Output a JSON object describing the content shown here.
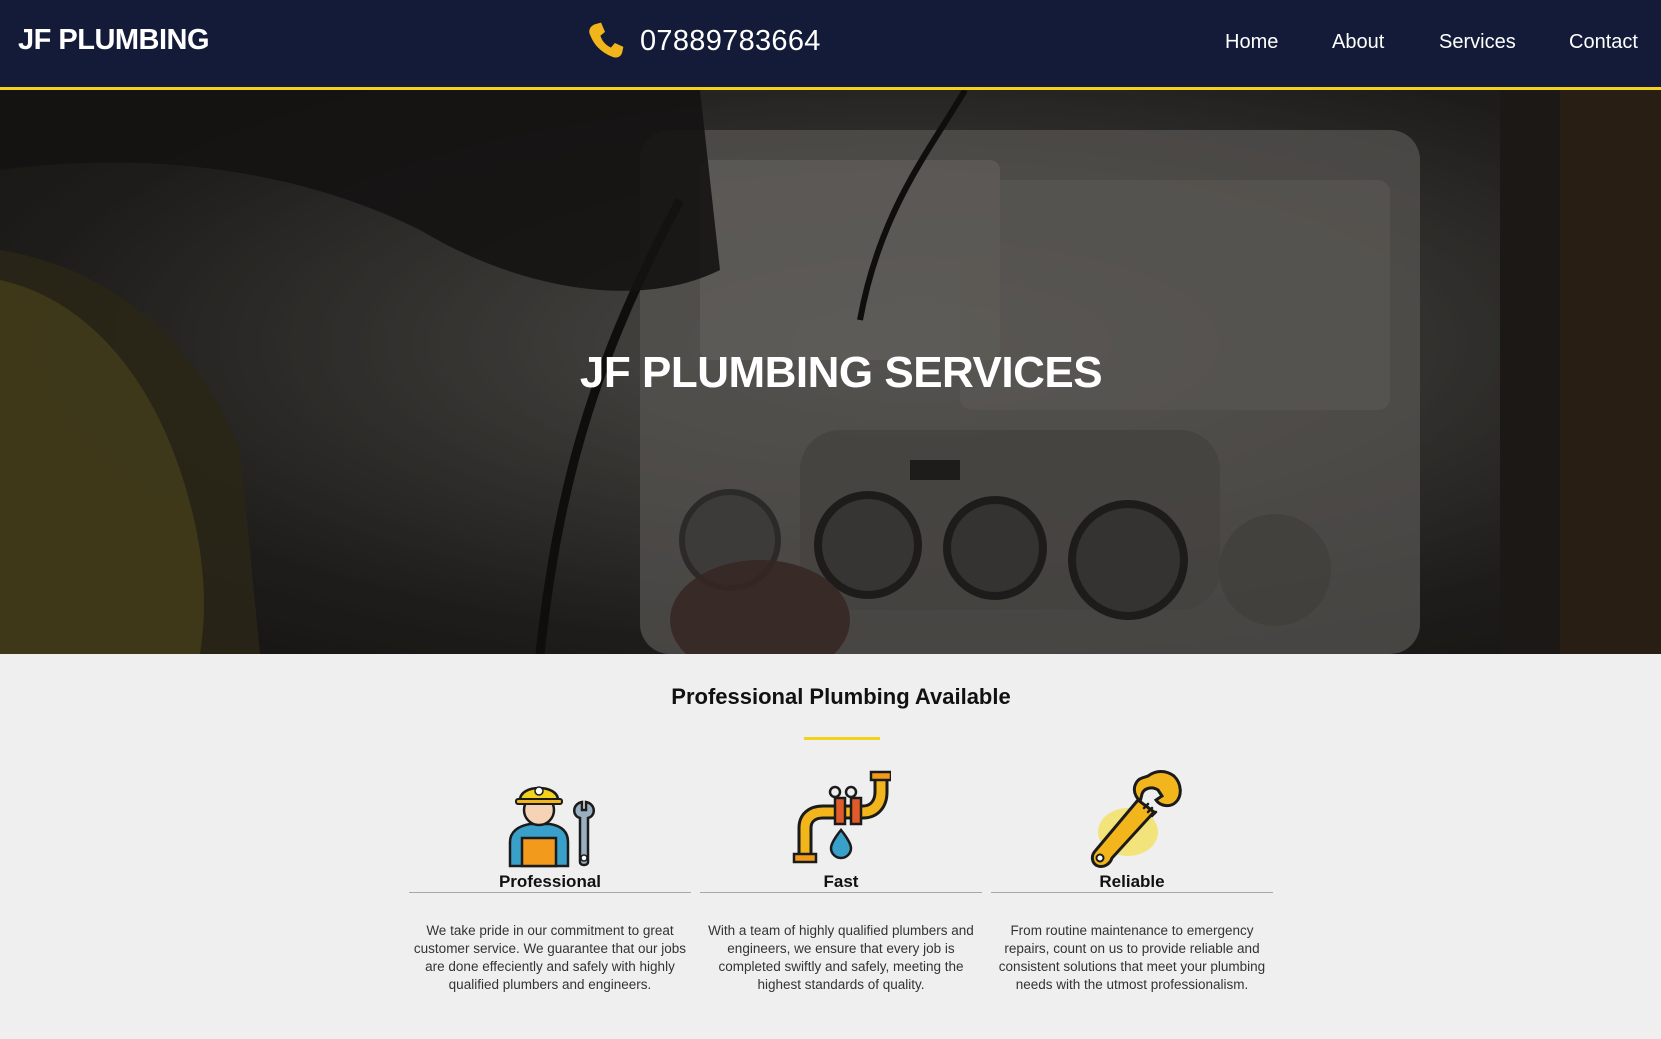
{
  "header": {
    "logo": "JF PLUMBING",
    "phone": "07889783664",
    "nav": [
      "Home",
      "About",
      "Services",
      "Contact"
    ]
  },
  "hero": {
    "title": "JF PLUMBING SERVICES"
  },
  "section": {
    "title": "Professional Plumbing Available",
    "features": [
      {
        "title": "Professional",
        "icon": "plumber-worker-icon",
        "text": "We take pride in our commitment to great customer service. We guarantee that our jobs are done effeciently and safely with highly qualified plumbers and engineers."
      },
      {
        "title": "Fast",
        "icon": "pipe-valve-leak-icon",
        "text": "With a team of highly qualified plumbers and engineers, we ensure that every job is completed swiftly and safely, meeting the highest standards of quality."
      },
      {
        "title": "Reliable",
        "icon": "wrench-icon",
        "text": "From routine maintenance to emergency repairs, count on us to provide reliable and consistent solutions that meet your plumbing needs with the utmost professionalism."
      }
    ]
  },
  "colors": {
    "nav_bg": "#131b38",
    "accent": "#f2d21b",
    "page_bg": "#efefef"
  }
}
